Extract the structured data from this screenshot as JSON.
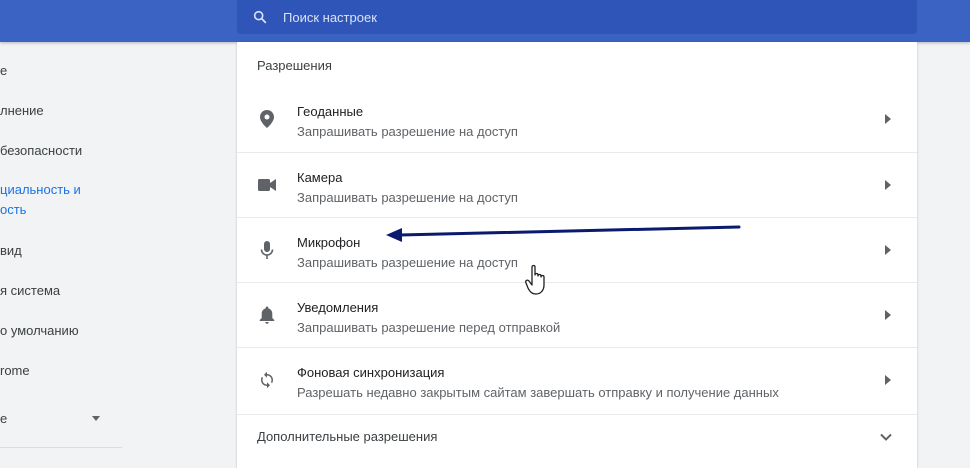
{
  "search": {
    "placeholder": "Поиск настроек",
    "icon": "search-icon"
  },
  "sidebar": {
    "items": [
      {
        "label": "е",
        "active": false
      },
      {
        "label": "лнение",
        "active": false
      },
      {
        "label": "безопасности",
        "active": false
      },
      {
        "label": "циальность и",
        "active": true
      },
      {
        "label": "ость",
        "active": true
      },
      {
        "label": "вид",
        "active": false
      },
      {
        "label": "я система",
        "active": false
      },
      {
        "label": "о умолчанию",
        "active": false
      },
      {
        "label": "rome",
        "active": false
      },
      {
        "label": "е",
        "active": false,
        "expandable": true
      }
    ],
    "accent_color": "#1a73e8"
  },
  "permissions": {
    "title": "Разрешения",
    "rows": [
      {
        "icon": "location-pin-icon",
        "title": "Геоданные",
        "subtitle": "Запрашивать разрешение на доступ"
      },
      {
        "icon": "camera-icon",
        "title": "Камера",
        "subtitle": "Запрашивать разрешение на доступ"
      },
      {
        "icon": "microphone-icon",
        "title": "Микрофон",
        "subtitle": "Запрашивать разрешение на доступ"
      },
      {
        "icon": "bell-icon",
        "title": "Уведомления",
        "subtitle": "Запрашивать разрешение перед отправкой"
      },
      {
        "icon": "sync-icon",
        "title": "Фоновая синхронизация",
        "subtitle": "Разрешать недавно закрытым сайтам завершать отправку и получение данных"
      }
    ],
    "more_label": "Дополнительные разрешения"
  },
  "colors": {
    "header": "#3b63c4",
    "search_bg": "#2e55b7",
    "annotation_arrow": "#0a1a6e"
  }
}
